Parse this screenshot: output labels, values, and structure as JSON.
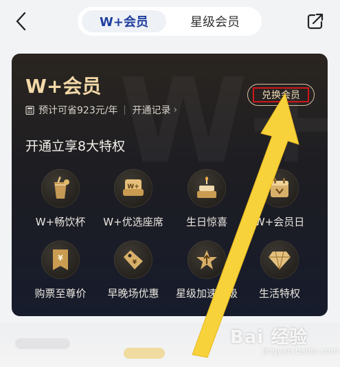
{
  "header": {
    "tabs": [
      {
        "label": "W+会员",
        "active": true
      },
      {
        "label": "星级会员",
        "active": false
      }
    ]
  },
  "card": {
    "watermark": "W+",
    "title": "W+会员",
    "savings_text": "预计可省923元/年",
    "record_link": "开通记录",
    "redeem_button": "兑换会员",
    "privileges_title": "开通立享8大特权",
    "perks": [
      {
        "label": "W+畅饮杯",
        "icon": "cup-icon"
      },
      {
        "label": "W+优选座席",
        "icon": "seat-icon"
      },
      {
        "label": "生日惊喜",
        "icon": "birthday-cake-icon"
      },
      {
        "label": "W+会员日",
        "icon": "calendar-icon"
      },
      {
        "label": "购票至尊价",
        "icon": "ticket-discount-icon"
      },
      {
        "label": "早晚场优惠",
        "icon": "price-tag-icon"
      },
      {
        "label": "星级加速升级",
        "icon": "star-upgrade-icon"
      },
      {
        "label": "生活特权",
        "icon": "diamond-icon"
      }
    ]
  },
  "watermark": {
    "text": "Bai 经验",
    "sub": "jingyan.baidu.com"
  },
  "colors": {
    "accent_gold": "#f3d9a8",
    "tab_active_text": "#1f3fa0",
    "highlight_red": "#d0161b",
    "arrow_yellow": "#f7d23a"
  }
}
